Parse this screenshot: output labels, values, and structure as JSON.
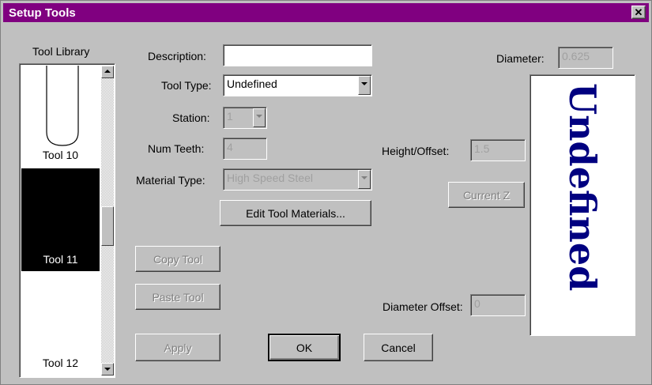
{
  "window": {
    "title": "Setup Tools",
    "close_label": "✕"
  },
  "tool_library": {
    "label": "Tool Library",
    "items": [
      {
        "name": "Tool 10",
        "selected": false
      },
      {
        "name": "Tool 11",
        "selected": true
      },
      {
        "name": "Tool 12",
        "selected": false
      }
    ]
  },
  "description": {
    "label": "Description:",
    "value": ""
  },
  "tool_type": {
    "label": "Tool Type:",
    "value": "Undefined"
  },
  "station": {
    "label": "Station:",
    "value": "1"
  },
  "num_teeth": {
    "label": "Num Teeth:",
    "value": "4"
  },
  "material_type": {
    "label": "Material Type:",
    "value": "High Speed Steel"
  },
  "edit_materials_button": "Edit Tool Materials...",
  "copy_tool_button": "Copy Tool",
  "paste_tool_button": "Paste Tool",
  "apply_button": "Apply",
  "ok_button": "OK",
  "cancel_button": "Cancel",
  "diameter": {
    "label": "Diameter:",
    "value": "0.625"
  },
  "height_offset": {
    "label": "Height/Offset:",
    "value": "1.5"
  },
  "current_z_button": "Current Z",
  "diameter_offset": {
    "label": "Diameter Offset:",
    "value": "0"
  },
  "preview": {
    "text": "Undefined",
    "color": "#000080"
  },
  "colors": {
    "titlebar": "#800080",
    "selection": "#000000"
  }
}
